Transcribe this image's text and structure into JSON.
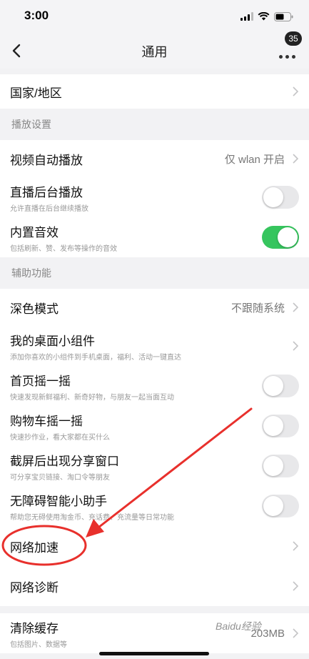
{
  "status": {
    "time": "3:00",
    "icons": [
      "signal-icon",
      "wifi-icon",
      "battery-icon"
    ]
  },
  "nav": {
    "title": "通用",
    "badge": "35",
    "back_icon": "chevron-left-icon",
    "more_icon": "more-icon"
  },
  "rows": {
    "region": {
      "label": "国家/地区"
    },
    "autoplay": {
      "label": "视频自动播放",
      "value": "仅 wlan 开启"
    },
    "live_bg": {
      "label": "直播后台播放",
      "desc": "允许直播在后台继续播放",
      "on": false
    },
    "sound": {
      "label": "内置音效",
      "desc": "包括刷新、赞、发布等操作的音效",
      "on": true
    },
    "dark": {
      "label": "深色模式",
      "value": "不跟随系统"
    },
    "widget": {
      "label": "我的桌面小组件",
      "desc": "添加你喜欢的小组件到手机桌面，福利、活动一键直达"
    },
    "shake_home": {
      "label": "首页摇一摇",
      "desc": "快速发现新鲜福利、新奇好物，与朋友一起当面互动",
      "on": false
    },
    "shake_cart": {
      "label": "购物车摇一摇",
      "desc": "快速抄作业，看大家都在买什么",
      "on": false
    },
    "screenshot": {
      "label": "截屏后出现分享窗口",
      "desc": "可分享宝贝链接、淘口令等朋友",
      "on": false
    },
    "assistant": {
      "label": "无障碍智能小助手",
      "desc": "帮助您无碍使用淘金币、充话费、充流量等日常功能",
      "on": false
    },
    "speedup": {
      "label": "网络加速"
    },
    "diagnose": {
      "label": "网络诊断"
    },
    "cache": {
      "label": "清除缓存",
      "desc": "包括图片、数据等",
      "value": "203MB"
    }
  },
  "sections": {
    "playback": "播放设置",
    "assist": "辅助功能"
  },
  "watermark": "Baidu经验",
  "colors": {
    "toggle_on": "#36c55e",
    "annotation": "#e8302c"
  }
}
